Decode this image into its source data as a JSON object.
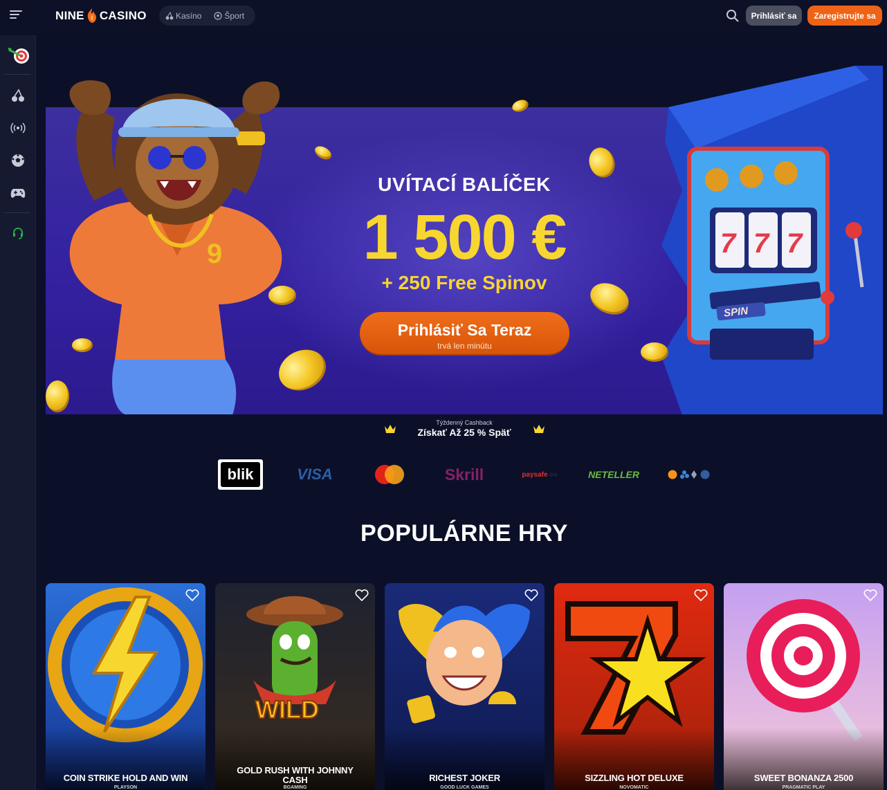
{
  "header": {
    "logo_left": "NINE",
    "logo_right": "CASINO",
    "nav": [
      {
        "label": "Kasíno",
        "icon": "cherry-icon"
      },
      {
        "label": "Šport",
        "icon": "soccer-ball-icon"
      }
    ],
    "login_label": "Prihlásiť sa",
    "register_label": "Zaregistrujte sa"
  },
  "sidebar": {
    "items": [
      {
        "icon": "dart-target-icon"
      },
      {
        "icon": "cherry-icon"
      },
      {
        "icon": "live-broadcast-icon"
      },
      {
        "icon": "soccer-ball-icon"
      },
      {
        "icon": "gamepad-icon"
      },
      {
        "icon": "support-headset-icon"
      }
    ]
  },
  "hero": {
    "subtitle": "UVÍTACÍ BALÍČEK",
    "amount": "1 500 €",
    "spins": "+ 250 Free Spinov",
    "cta_label": "Prihlásiť Sa Teraz",
    "cta_sub": "trvá len minútu",
    "slot_label": "SPIN",
    "reel_symbol": "7"
  },
  "cashback": {
    "small": "Týždenný Cashback",
    "big": "Získať Až 25 % Späť"
  },
  "payments": [
    "blik",
    "VISA",
    "mastercard",
    "Skrill",
    "paysafecard",
    "NETELLER",
    "crypto"
  ],
  "payment_text": {
    "blik": "blik",
    "visa": "VISA",
    "skrill": "Skrill",
    "paysafe": "paysafe",
    "neteller": "NETELLER"
  },
  "section_title": "POPULÁRNE HRY",
  "games": [
    {
      "name": "COIN STRIKE HOLD AND WIN",
      "provider": "PLAYSON"
    },
    {
      "name": "GOLD RUSH WITH JOHNNY CASH",
      "provider": "BGAMING",
      "art_text": "WILD"
    },
    {
      "name": "RICHEST JOKER",
      "provider": "GOOD LUCK GAMES"
    },
    {
      "name": "SIZZLING HOT DELUXE",
      "provider": "NOVOMATIC"
    },
    {
      "name": "SWEET BONANZA 2500",
      "provider": "PRAGMATIC PLAY"
    }
  ],
  "colors": {
    "background": "#0b1028",
    "accent_orange": "#ee6315",
    "gold": "#f8d630",
    "hero_purple": "#3321a0"
  }
}
